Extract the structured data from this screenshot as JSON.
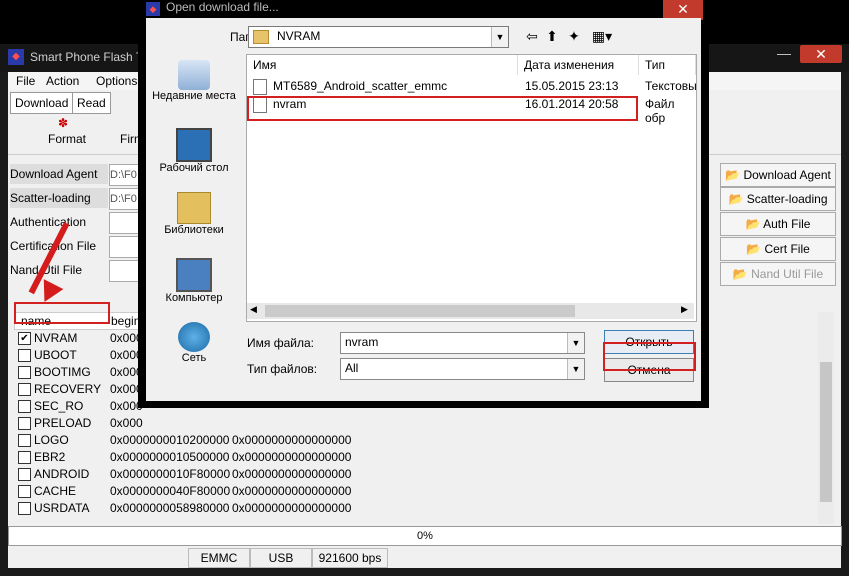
{
  "dialog": {
    "title": "Open download file...",
    "close_label": "✕",
    "folder_label": "Папка:",
    "folder_value": "NVRAM",
    "places": [
      "Недавние места",
      "Рабочий стол",
      "Библиотеки",
      "Компьютер",
      "Сеть"
    ],
    "columns": {
      "name": "Имя",
      "date": "Дата изменения",
      "type": "Тип"
    },
    "files": [
      {
        "name": "MT6589_Android_scatter_emmc",
        "date": "15.05.2015 23:13",
        "type": "Текстовы"
      },
      {
        "name": "nvram",
        "date": "16.01.2014 20:58",
        "type": "Файл обр"
      }
    ],
    "filename_label": "Имя файла:",
    "filename_value": "nvram",
    "filetype_label": "Тип файлов:",
    "filetype_value": "All",
    "open_label": "Открыть",
    "cancel_label": "Отмена"
  },
  "app": {
    "title": "Smart Phone Flash Tool",
    "menu": [
      "File",
      "Action",
      "Options"
    ],
    "tabs": [
      "Download",
      "Read back"
    ],
    "toolbar": {
      "format_label": "Format",
      "firmware_label": "Firm"
    },
    "fields": [
      {
        "label": "Download Agent",
        "value": "D:\\F0"
      },
      {
        "label": "Scatter-loading File",
        "value": "D:\\F0"
      },
      {
        "label": "Authentication File",
        "value": ""
      },
      {
        "label": "Certification File",
        "value": ""
      },
      {
        "label": "Nand Util File",
        "value": ""
      }
    ],
    "right_buttons": [
      "Download Agent",
      "Scatter-loading",
      "Auth File",
      "Cert File",
      "Nand Util File"
    ],
    "table_headers": {
      "name": "name",
      "begin": "begin"
    },
    "rows": [
      {
        "name": "NVRAM",
        "checked": true,
        "begin": "0x000",
        "end": ""
      },
      {
        "name": "UBOOT",
        "checked": false,
        "begin": "0x000",
        "end": ""
      },
      {
        "name": "BOOTIMG",
        "checked": false,
        "begin": "0x000",
        "end": ""
      },
      {
        "name": "RECOVERY",
        "checked": false,
        "begin": "0x000",
        "end": ""
      },
      {
        "name": "SEC_RO",
        "checked": false,
        "begin": "0x000",
        "end": ""
      },
      {
        "name": "PRELOAD",
        "checked": false,
        "begin": "0x000",
        "end": ""
      },
      {
        "name": "LOGO",
        "checked": false,
        "begin": "0x0000000010200000",
        "end": "0x0000000000000000"
      },
      {
        "name": "EBR2",
        "checked": false,
        "begin": "0x0000000010500000",
        "end": "0x0000000000000000"
      },
      {
        "name": "ANDROID",
        "checked": false,
        "begin": "0x0000000010F80000",
        "end": "0x0000000000000000"
      },
      {
        "name": "CACHE",
        "checked": false,
        "begin": "0x0000000040F80000",
        "end": "0x0000000000000000"
      },
      {
        "name": "USRDATA",
        "checked": false,
        "begin": "0x0000000058980000",
        "end": "0x0000000000000000"
      }
    ],
    "progress": "0%",
    "status": [
      "EMMC",
      "USB",
      "921600 bps"
    ]
  }
}
